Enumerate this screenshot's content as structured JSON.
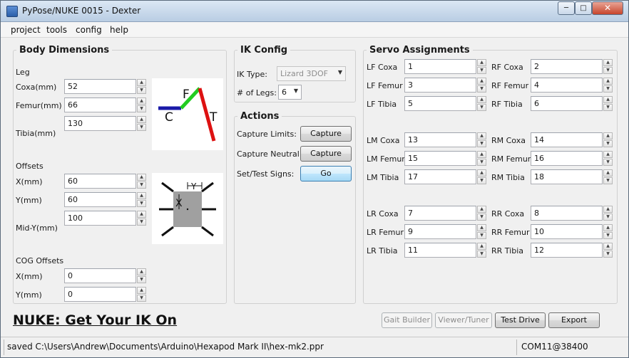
{
  "window": {
    "title": "PyPose/NUKE 0015 - Dexter",
    "minimize_label": "─",
    "maximize_label": "□",
    "close_label": "✕"
  },
  "menu": [
    "project",
    "tools",
    "config",
    "help"
  ],
  "body_dimensions": {
    "title": "Body Dimensions",
    "leg_heading": "Leg",
    "coxa_label": "Coxa(mm)",
    "coxa_value": "52",
    "femur_label": "Femur(mm)",
    "femur_value": "66",
    "tibia_label": "Tibia(mm)",
    "tibia_value": "130",
    "leg_diagram": {
      "c_label": "C",
      "f_label": "F",
      "t_label": "T"
    },
    "offsets_heading": "Offsets",
    "x_label": "X(mm)",
    "x_value": "60",
    "y_label": "Y(mm)",
    "y_value": "60",
    "midy_label": "Mid-Y(mm)",
    "midy_value": "100",
    "body_diagram": {
      "x_label": "X",
      "y_label": "Y"
    },
    "cog_heading": "COG Offsets",
    "cog_x_label": "X(mm)",
    "cog_x_value": "0",
    "cog_y_label": "Y(mm)",
    "cog_y_value": "0"
  },
  "ik_config": {
    "title": "IK Config",
    "type_label": "IK Type:",
    "type_value": "Lizard 3DOF",
    "legs_label": "# of Legs:",
    "legs_value": "6"
  },
  "actions": {
    "title": "Actions",
    "limits_label": "Capture Limits:",
    "limits_button": "Capture",
    "neutral_label": "Capture Neutral:",
    "neutral_button": "Capture",
    "signs_label": "Set/Test Signs:",
    "signs_button": "Go"
  },
  "servo": {
    "title": "Servo Assignments",
    "left": [
      {
        "label": "LF Coxa",
        "value": "1"
      },
      {
        "label": "LF Femur",
        "value": "3"
      },
      {
        "label": "LF Tibia",
        "value": "5"
      },
      {
        "label": "LM Coxa",
        "value": "13"
      },
      {
        "label": "LM Femur",
        "value": "15"
      },
      {
        "label": "LM Tibia",
        "value": "17"
      },
      {
        "label": "LR Coxa",
        "value": "7"
      },
      {
        "label": "LR Femur",
        "value": "9"
      },
      {
        "label": "LR Tibia",
        "value": "11"
      }
    ],
    "right": [
      {
        "label": "RF Coxa",
        "value": "2"
      },
      {
        "label": "RF Femur",
        "value": "4"
      },
      {
        "label": "RF Tibia",
        "value": "6"
      },
      {
        "label": "RM Coxa",
        "value": "14"
      },
      {
        "label": "RM Femur",
        "value": "16"
      },
      {
        "label": "RM Tibia",
        "value": "18"
      },
      {
        "label": "RR Coxa",
        "value": "8"
      },
      {
        "label": "RR Femur",
        "value": "10"
      },
      {
        "label": "RR Tibia",
        "value": "12"
      }
    ]
  },
  "footer": {
    "tagline": "NUKE: Get Your IK On",
    "gait_builder": "Gait Builder",
    "viewer_tuner": "Viewer/Tuner",
    "test_drive": "Test Drive",
    "export": "Export"
  },
  "status": {
    "message": "saved C:\\Users\\Andrew\\Documents\\Arduino\\Hexapod Mark II\\hex-mk2.ppr",
    "port": "COM11@38400"
  },
  "colors": {
    "coxa": "#1a1aa8",
    "femur": "#22cc22",
    "tibia": "#dd1111",
    "body_fill": "#a0a0a0"
  }
}
